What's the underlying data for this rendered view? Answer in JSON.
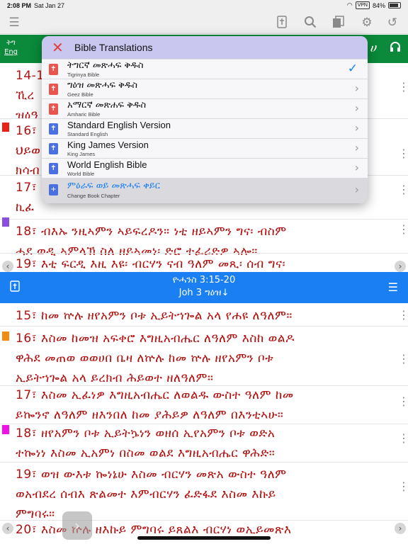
{
  "status_bar": {
    "time": "2:08 PM",
    "date": "Sat Jan 27",
    "vpn": "VPN",
    "battery": "84%"
  },
  "toolbar": {
    "icons": [
      "menu-icon",
      "bible-book-icon",
      "search-icon",
      "bookmarks-icon",
      "settings-icon",
      "history-icon"
    ]
  },
  "header": {
    "lang_toggle_top": "ትግ",
    "lang_toggle_bottom": "Eng",
    "right_text": "ሀ",
    "audio_icon": "headphones-icon"
  },
  "upper_pane": {
    "verses": [
      {
        "lines": [
          "14-1",
          "ኺረ",
          "ዝዕዓ"
        ]
      },
      {
        "lines": [
          "16፣ ",
          "ህይወ",
          "ክሳብ"
        ]
      },
      {
        "lines": [
          "17፣ ",
          "ኪፈ"
        ]
      },
      {
        "lines": [
          "18፣ ብእኡ ንዚኣምን ኣይፍረዶን። ነቲ ዘይኣምን ግና፡ ብስም",
          "ሓደ ወዲ ኣምላኽ ስለ ዘይኣመነ፡ ድሮ ተፈሪድዎ ኣሎ።"
        ]
      },
      {
        "lines": [
          "19፣ እቲ ፍርዲ እዚ እዩ፡ ብርሃን ናብ ዓለም መጺ፡ ሰብ ግና፡"
        ]
      }
    ]
  },
  "divider": {
    "reference_top": "ዮሓንስ 3:15-20",
    "reference_bottom": "Joh 3 ግዕዝ↓"
  },
  "lower_pane": {
    "verses": [
      {
        "lines": [
          "15፣ ከመ ኵሉ ዘየአምን ቦቱ ኢይትኀጐል አላ የሐዩ ለዓለም።"
        ]
      },
      {
        "lines": [
          "16፣ እስመ ከመዝ አፍቀሮ እግዚአብሔር ለዓለም እስከ ወልዶ",
          "ዋሕደ መጠወ ወወሀበ ቤዛ ለኵሉ ከመ ኵሉ ዘየአምን ቦቱ",
          "ኢይትኀጐል አላ ይረክብ ሕይወተ ዘለዓለም።"
        ]
      },
      {
        "lines": [
          "17፣ እስመ ኢፈነዎ እግዚአብሔር ለወልዱ ውስተ ዓለም ከመ",
          "ይኰንኖ ለዓለም ዘእንበለ ከመ ያሕይዎ ለዓለም በእንቲኣሁ።"
        ]
      },
      {
        "lines": [
          "18፣ ዘየአምን ቦቱ ኢይትኴነን ወዘሰ ኢየአምን ቦቱ ወድአ",
          "ተኰነነ እስመ ኢአምነ በስመ ወልደ እግዚአብሔር ዋሕድ።"
        ]
      },
      {
        "lines": [
          "19፣ ወዝ ውእቱ ኰነኔሁ እስመ ብርሃን መጽአ ውስተ ዓለም",
          "ወአብደረ ሰብእ ጽልመተ እምብርሃን ፈድፋደ እስመ እኩይ",
          "ምግባሩ።"
        ]
      },
      {
        "lines": [
          "20፣ እስመ ኵሉ ዘእኩይ ምግባሩ ይጸልእ ብርሃነ ወኢይመጽእ"
        ]
      }
    ]
  },
  "popup": {
    "title": "Bible Translations",
    "items": [
      {
        "main": "ትግርኛ መጽሓፍ ቅዱስ",
        "sub": "Tigrinya Bible",
        "trail": "✓"
      },
      {
        "main": "ግዕዝ መጽሓፍ ቅዱስ",
        "sub": "Geez Bible",
        "trail": "›"
      },
      {
        "main": "አማርኛ መጽሐፍ ቅዱስ",
        "sub": "Amharic Bible",
        "trail": "›"
      },
      {
        "main": "Standard English Version",
        "sub": "Standard English",
        "trail": "›"
      },
      {
        "main": "King James Version",
        "sub": "King James",
        "trail": "›"
      },
      {
        "main": "World English Bible",
        "sub": "World Bible",
        "trail": "›"
      }
    ],
    "change_book": {
      "main": "ምዕራፍ ወይ መጽሓፍ ቀይር",
      "sub": "Change Book Chapter",
      "trail": "›"
    }
  },
  "colors": {
    "green": "#0a8a3a",
    "blue": "#1a7ff2",
    "verse_red": "#b20f0f",
    "bookmark_red": "#e8201a",
    "bookmark_purple": "#8a4fe0",
    "bookmark_orange": "#f08a10",
    "bookmark_magenta": "#f010e8"
  }
}
